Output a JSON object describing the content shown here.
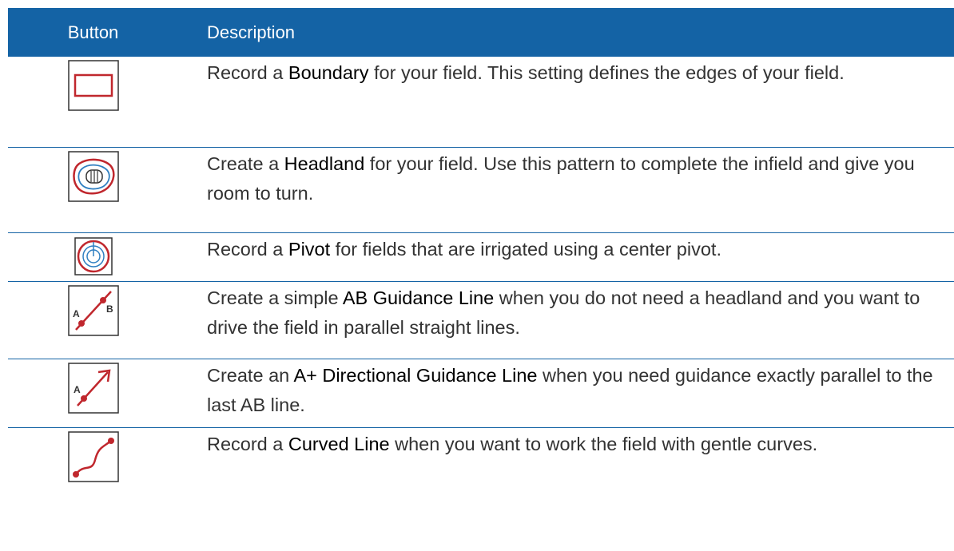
{
  "header": {
    "col_button": "Button",
    "col_description": "Description"
  },
  "rows": [
    {
      "icon": "boundary-icon",
      "pre": "Record a ",
      "bold": "Boundary",
      "post": " for your field. This setting defines the edges of your field."
    },
    {
      "icon": "headland-icon",
      "pre": "Create a ",
      "bold": "Headland",
      "post": " for your field. Use this pattern to complete the infield and give you room to turn."
    },
    {
      "icon": "pivot-icon",
      "pre": "Record a ",
      "bold": "Pivot",
      "post": " for fields that are irrigated using a center pivot."
    },
    {
      "icon": "ab-line-icon",
      "pre": "Create a simple ",
      "bold": "AB Guidance Line",
      "post": " when you do not need a headland and you want to drive the field in parallel straight lines."
    },
    {
      "icon": "a-plus-line-icon",
      "pre": "Create an ",
      "bold": "A+ Directional Guidance Line",
      "post": " when you need guidance exactly parallel to the last AB line."
    },
    {
      "icon": "curved-line-icon",
      "pre": "Record a ",
      "bold": "Curved Line",
      "post": " when you want to work the field with gentle curves."
    }
  ],
  "icon_labels": {
    "a": "A",
    "b": "B"
  },
  "colors": {
    "header_bg": "#1463a5",
    "icon_red": "#c0272d",
    "icon_blue": "#2f7fc1"
  }
}
